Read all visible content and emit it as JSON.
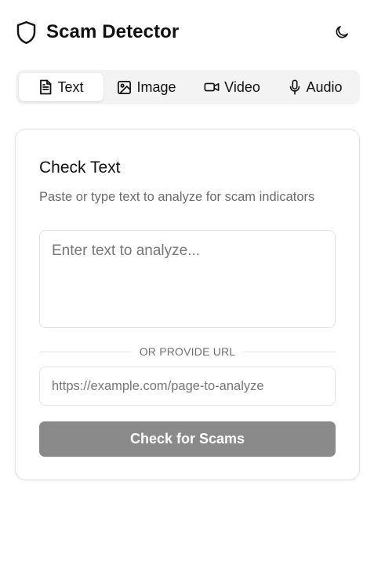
{
  "header": {
    "title": "Scam Detector",
    "logo_icon": "shield-icon",
    "theme_toggle_icon": "moon-icon"
  },
  "tabs": [
    {
      "label": "Text",
      "icon": "file-text-icon",
      "active": true
    },
    {
      "label": "Image",
      "icon": "image-icon",
      "active": false
    },
    {
      "label": "Video",
      "icon": "video-icon",
      "active": false
    },
    {
      "label": "Audio",
      "icon": "microphone-icon",
      "active": false
    }
  ],
  "card": {
    "title": "Check Text",
    "description": "Paste or type text to analyze for scam indicators",
    "text_input": {
      "value": "",
      "placeholder": "Enter text to analyze..."
    },
    "divider_label": "OR PROVIDE URL",
    "url_input": {
      "value": "",
      "placeholder": "https://example.com/page-to-analyze"
    },
    "submit_label": "Check for Scams"
  },
  "colors": {
    "button_disabled_bg": "#8a8a8a",
    "tab_bar_bg": "#f3f3f3",
    "active_tab_bg": "#ffffff",
    "muted_text": "#6b6b6b"
  }
}
